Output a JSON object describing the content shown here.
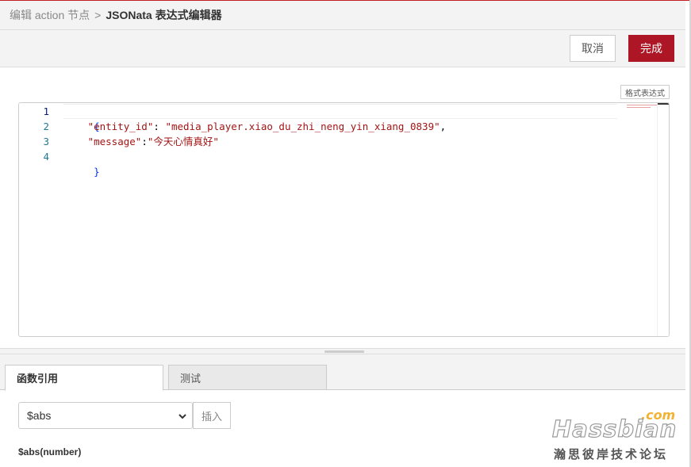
{
  "breadcrumb": {
    "parent": "编辑 action 节点",
    "separator": ">",
    "current": "JSONata 表达式编辑器"
  },
  "toolbar": {
    "cancel_label": "取消",
    "done_label": "完成",
    "format_label": "格式表达式"
  },
  "editor": {
    "line_numbers": [
      "1",
      "2",
      "3",
      "4"
    ],
    "lines": {
      "l1": {
        "brace": "{"
      },
      "l2": {
        "indent": "   ",
        "key": "\"entity_id\"",
        "colon": ": ",
        "value": "\"media_player.xiao_du_zhi_neng_yin_xiang_0839\"",
        "comma": ","
      },
      "l3": {
        "indent": "   ",
        "key": "\"message\"",
        "colon": ":",
        "value": "\"今天心情真好\""
      },
      "l4": {
        "brace": "}"
      }
    }
  },
  "tabs": [
    {
      "label": "函数引用"
    },
    {
      "label": "测试"
    }
  ],
  "function_select": {
    "selected": "$abs",
    "insert_label": "插入"
  },
  "function_signature": "$abs(number)",
  "watermark": {
    "name": "Hassbian",
    "suffix": ".com",
    "subtitle": "瀚思彼岸技术论坛"
  },
  "colors": {
    "accent": "#ad1625",
    "line_number": "#237893",
    "string": "#a31515",
    "brace": "#0431fa"
  }
}
